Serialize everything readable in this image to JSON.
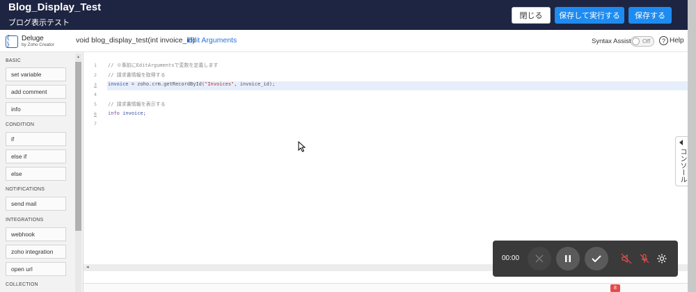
{
  "header": {
    "title": "Blog_Display_Test",
    "subtitle": "ブログ表示テスト",
    "close_label": "閉じる",
    "save_run_label": "保存して実行する",
    "save_label": "保存する"
  },
  "subheader": {
    "product_name": "Deluge",
    "product_by": "by Zoho Creator",
    "function_signature": "void blog_display_test(int invoice_id)",
    "edit_arguments_label": "Edit Arguments",
    "syntax_assist_label": "Syntax Assist",
    "syntax_assist_state": "Off",
    "help_label": "Help"
  },
  "sidebar": {
    "sections": [
      {
        "title": "BASIC",
        "items": [
          "set variable",
          "add comment",
          "info"
        ]
      },
      {
        "title": "CONDITION",
        "items": [
          "if",
          "else if",
          "else"
        ]
      },
      {
        "title": "NOTIFICATIONS",
        "items": [
          "send mail"
        ]
      },
      {
        "title": "INTEGRATIONS",
        "items": [
          "webhook",
          "zoho integration",
          "open url"
        ]
      },
      {
        "title": "COLLECTION",
        "items": []
      }
    ]
  },
  "editor": {
    "line_numbers": [
      "1",
      "2",
      "3",
      "4",
      "5",
      "6",
      "7"
    ],
    "lines": [
      {
        "parts": [
          {
            "t": "// ※事前にEditArgumentsで変数を定義します",
            "c": "comment"
          }
        ]
      },
      {
        "parts": [
          {
            "t": "// 請求書情報を取得する",
            "c": "comment"
          }
        ]
      },
      {
        "parts": [
          {
            "t": "invoice",
            "c": "ident"
          },
          {
            "t": " = ",
            "c": "plain"
          },
          {
            "t": "zoho.crm.getRecordById(",
            "c": "plain"
          },
          {
            "t": "\"Invoices\"",
            "c": "string"
          },
          {
            "t": ", invoice_id);",
            "c": "plain"
          }
        ]
      },
      {
        "parts": []
      },
      {
        "parts": [
          {
            "t": "// 請求書情報を表示する",
            "c": "comment"
          }
        ]
      },
      {
        "parts": [
          {
            "t": "info ",
            "c": "kw"
          },
          {
            "t": "invoice;",
            "c": "ident"
          }
        ]
      },
      {
        "parts": []
      }
    ],
    "badge_count": "8"
  },
  "console": {
    "label": "コンソール"
  },
  "recorder": {
    "time": "00:00"
  },
  "colors": {
    "header_bg": "#1e2542",
    "primary_button": "#1e8bf0",
    "link": "#2672d9"
  }
}
